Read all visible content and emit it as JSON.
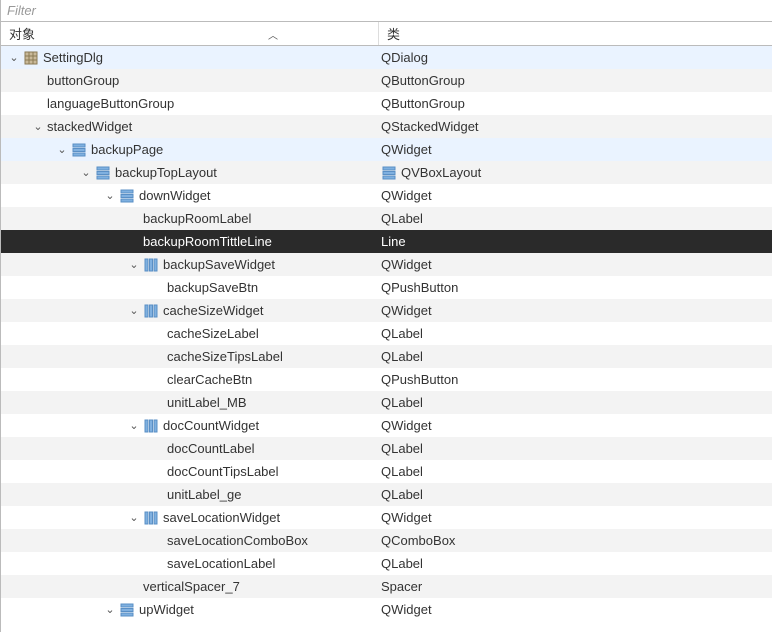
{
  "filter": {
    "placeholder": "Filter"
  },
  "header": {
    "object": "对象",
    "class": "类"
  },
  "rows": [
    {
      "depth": 0,
      "expand": "open",
      "icon": "grid",
      "name": "SettingDlg",
      "cls": "QDialog",
      "hl": true,
      "cls_icon": ""
    },
    {
      "depth": 1,
      "expand": "none",
      "icon": "",
      "name": "buttonGroup",
      "cls": "QButtonGroup",
      "alt": true,
      "cls_icon": ""
    },
    {
      "depth": 1,
      "expand": "none",
      "icon": "",
      "name": "languageButtonGroup",
      "cls": "QButtonGroup",
      "cls_icon": ""
    },
    {
      "depth": 1,
      "expand": "open",
      "icon": "",
      "name": "stackedWidget",
      "cls": "QStackedWidget",
      "alt": true,
      "cls_icon": ""
    },
    {
      "depth": 2,
      "expand": "open",
      "icon": "layout",
      "name": "backupPage",
      "cls": "QWidget",
      "hl": true,
      "cls_icon": ""
    },
    {
      "depth": 3,
      "expand": "open",
      "icon": "layout",
      "name": "backupTopLayout",
      "cls": "QVBoxLayout",
      "alt": true,
      "cls_icon": "layout"
    },
    {
      "depth": 4,
      "expand": "open",
      "icon": "layout",
      "name": "downWidget",
      "cls": "QWidget",
      "cls_icon": ""
    },
    {
      "depth": 5,
      "expand": "none",
      "icon": "",
      "name": "backupRoomLabel",
      "cls": "QLabel",
      "alt": true,
      "cls_icon": ""
    },
    {
      "depth": 5,
      "expand": "none",
      "icon": "",
      "name": "backupRoomTittleLine",
      "cls": "Line",
      "sel": true,
      "cls_icon": ""
    },
    {
      "depth": 5,
      "expand": "open",
      "icon": "hbox",
      "name": "backupSaveWidget",
      "cls": "QWidget",
      "alt": true,
      "cls_icon": ""
    },
    {
      "depth": 6,
      "expand": "none",
      "icon": "",
      "name": "backupSaveBtn",
      "cls": "QPushButton",
      "cls_icon": ""
    },
    {
      "depth": 5,
      "expand": "open",
      "icon": "hbox",
      "name": "cacheSizeWidget",
      "cls": "QWidget",
      "alt": true,
      "cls_icon": ""
    },
    {
      "depth": 6,
      "expand": "none",
      "icon": "",
      "name": "cacheSizeLabel",
      "cls": "QLabel",
      "cls_icon": ""
    },
    {
      "depth": 6,
      "expand": "none",
      "icon": "",
      "name": "cacheSizeTipsLabel",
      "cls": "QLabel",
      "alt": true,
      "cls_icon": ""
    },
    {
      "depth": 6,
      "expand": "none",
      "icon": "",
      "name": "clearCacheBtn",
      "cls": "QPushButton",
      "cls_icon": ""
    },
    {
      "depth": 6,
      "expand": "none",
      "icon": "",
      "name": "unitLabel_MB",
      "cls": "QLabel",
      "alt": true,
      "cls_icon": ""
    },
    {
      "depth": 5,
      "expand": "open",
      "icon": "hbox",
      "name": "docCountWidget",
      "cls": "QWidget",
      "cls_icon": ""
    },
    {
      "depth": 6,
      "expand": "none",
      "icon": "",
      "name": "docCountLabel",
      "cls": "QLabel",
      "alt": true,
      "cls_icon": ""
    },
    {
      "depth": 6,
      "expand": "none",
      "icon": "",
      "name": "docCountTipsLabel",
      "cls": "QLabel",
      "cls_icon": ""
    },
    {
      "depth": 6,
      "expand": "none",
      "icon": "",
      "name": "unitLabel_ge",
      "cls": "QLabel",
      "alt": true,
      "cls_icon": ""
    },
    {
      "depth": 5,
      "expand": "open",
      "icon": "hbox",
      "name": "saveLocationWidget",
      "cls": "QWidget",
      "cls_icon": ""
    },
    {
      "depth": 6,
      "expand": "none",
      "icon": "",
      "name": "saveLocationComboBox",
      "cls": "QComboBox",
      "alt": true,
      "cls_icon": ""
    },
    {
      "depth": 6,
      "expand": "none",
      "icon": "",
      "name": "saveLocationLabel",
      "cls": "QLabel",
      "cls_icon": ""
    },
    {
      "depth": 5,
      "expand": "none",
      "icon": "",
      "name": "verticalSpacer_7",
      "cls": "Spacer",
      "alt": true,
      "cls_icon": ""
    },
    {
      "depth": 4,
      "expand": "open",
      "icon": "layout",
      "name": "upWidget",
      "cls": "QWidget",
      "cls_icon": ""
    }
  ]
}
